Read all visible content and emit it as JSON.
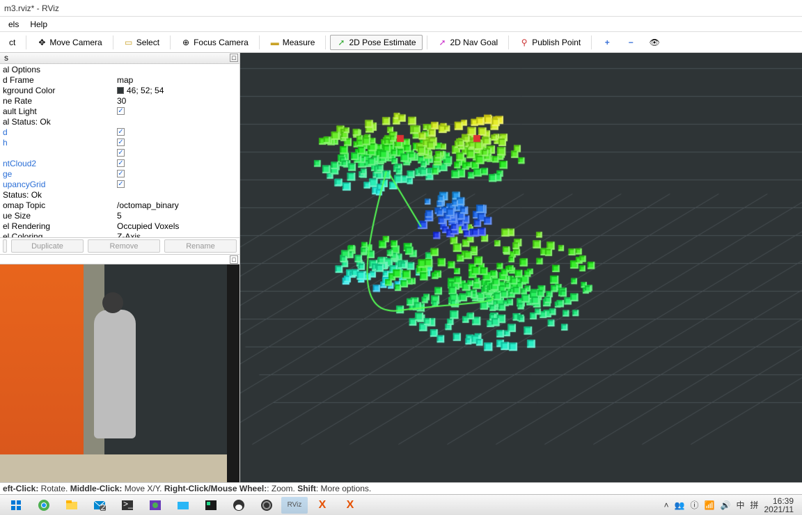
{
  "window": {
    "title": "m3.rviz* - RViz"
  },
  "menu": {
    "panels": "els",
    "help": "Help"
  },
  "toolbar": {
    "interact": "ct",
    "move_camera": "Move Camera",
    "select": "Select",
    "focus_camera": "Focus Camera",
    "measure": "Measure",
    "pose_estimate": "2D Pose Estimate",
    "nav_goal": "2D Nav Goal",
    "publish_point": "Publish Point"
  },
  "panel": {
    "head": "s"
  },
  "props": {
    "global_options": "al Options",
    "fixed_frame_k": "d Frame",
    "fixed_frame_v": "map",
    "bg_color_k": "kground Color",
    "bg_color_v": "46; 52; 54",
    "frame_rate_k": "ne Rate",
    "frame_rate_v": "30",
    "default_light_k": "ault Light",
    "global_status_k": "al Status: Ok",
    "grid_k": "d",
    "path_k": "h",
    "empty_k": "",
    "pointcloud_k": "ntCloud2",
    "image_k": "ge",
    "occupancy_k": "upancyGrid",
    "status_k": "Status: Ok",
    "topic_k": "omap Topic",
    "topic_v": "/octomap_binary",
    "queue_k": "ue Size",
    "queue_v": "5",
    "rendering_k": "el Rendering",
    "rendering_v": "Occupied Voxels",
    "coloring_k": "el Coloring",
    "coloring_v": "Z-Axis"
  },
  "buttons": {
    "dup": "Duplicate",
    "rem": "Remove",
    "ren": "Rename"
  },
  "status": {
    "left_click": "eft-Click:",
    "left_action": " Rotate. ",
    "mid_click": "Middle-Click:",
    "mid_action": " Move X/Y. ",
    "right_click": "Right-Click/Mouse Wheel:",
    "right_action": ": Zoom. ",
    "shift": "Shift",
    "shift_action": ": More options."
  },
  "tray": {
    "lang": "中",
    "ime": "拼",
    "time": "16:39",
    "date": "2021/11"
  }
}
